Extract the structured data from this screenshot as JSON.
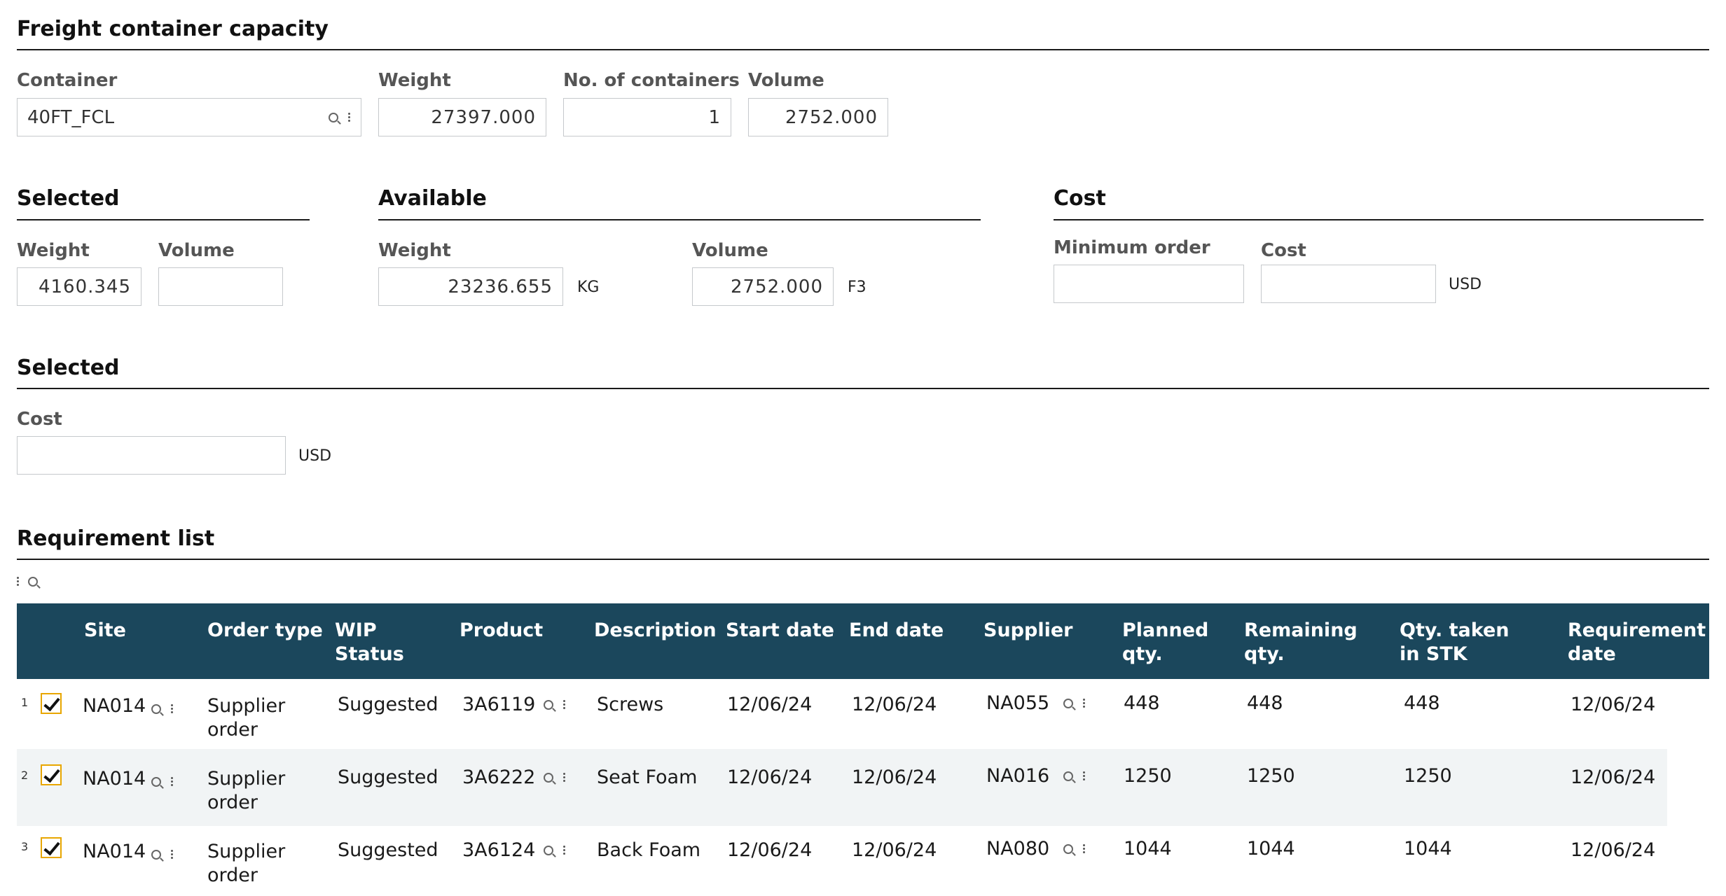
{
  "freight": {
    "title": "Freight container capacity",
    "container_label": "Container",
    "container_value": "40FT_FCL",
    "weight_label": "Weight",
    "weight_value": "27397.000",
    "containers_label": "No. of containers",
    "containers_value": "1",
    "volume_label": "Volume",
    "volume_value": "2752.000"
  },
  "selected": {
    "title": "Selected",
    "weight_label": "Weight",
    "weight_value": "4160.345",
    "volume_label": "Volume",
    "volume_value": ""
  },
  "available": {
    "title": "Available",
    "weight_label": "Weight",
    "weight_value": "23236.655",
    "weight_unit": "KG",
    "volume_label": "Volume",
    "volume_value": "2752.000",
    "volume_unit": "F3"
  },
  "cost": {
    "title": "Cost",
    "min_order_label": "Minimum order",
    "min_order_value": "",
    "cost_label": "Cost",
    "cost_value": "",
    "cost_unit": "USD"
  },
  "selected2": {
    "title": "Selected",
    "cost_label": "Cost",
    "cost_value": "",
    "cost_unit": "USD"
  },
  "requirements": {
    "title": "Requirement list",
    "columns": [
      "Site",
      "Order type",
      "WIP\nStatus",
      "Product",
      "Description",
      "Start date",
      "End date",
      "Supplier",
      "Planned\nqty.",
      "Remaining\nqty.",
      "Qty. taken\nin STK",
      "Requirement\ndate"
    ],
    "rows": [
      {
        "num": "1",
        "site": "NA014",
        "order_type": "Supplier\norder",
        "wip": "Suggested",
        "product": "3A6119",
        "description": "Screws",
        "start": "12/06/24",
        "end": "12/06/24",
        "supplier": "NA055",
        "planned": "448",
        "remaining": "448",
        "taken": "448",
        "req_date": "12/06/24"
      },
      {
        "num": "2",
        "site": "NA014",
        "order_type": "Supplier\norder",
        "wip": "Suggested",
        "product": "3A6222",
        "description": "Seat Foam",
        "start": "12/06/24",
        "end": "12/06/24",
        "supplier": "NA016",
        "planned": "1250",
        "remaining": "1250",
        "taken": "1250",
        "req_date": "12/06/24"
      },
      {
        "num": "3",
        "site": "NA014",
        "order_type": "Supplier\norder",
        "wip": "Suggested",
        "product": "3A6124",
        "description": "Back Foam",
        "start": "12/06/24",
        "end": "12/06/24",
        "supplier": "NA080",
        "planned": "1044",
        "remaining": "1044",
        "taken": "1044",
        "req_date": "12/06/24"
      }
    ]
  },
  "colors": {
    "header_bg": "#1b475c",
    "checkbox_border": "#e8a600",
    "alt_row_bg": "#f1f4f5"
  }
}
